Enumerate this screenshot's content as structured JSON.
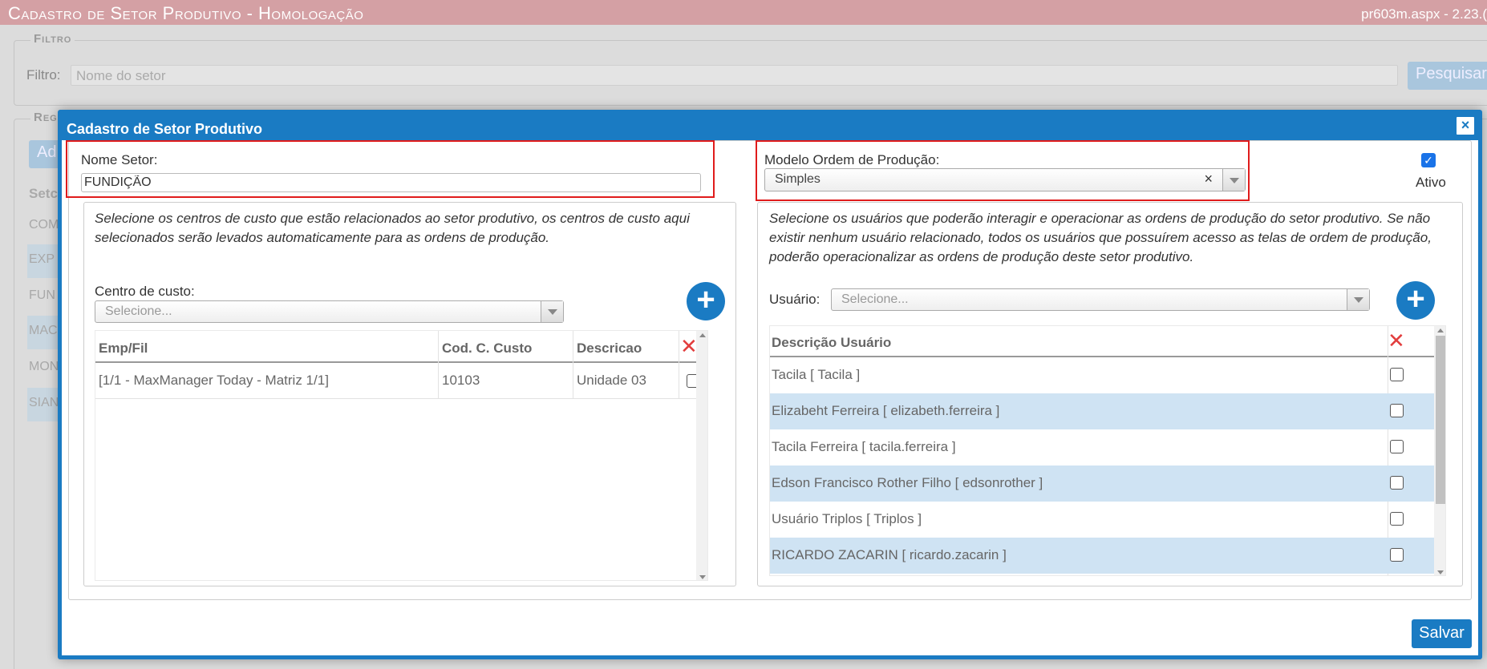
{
  "page": {
    "title": "Cadastro de Setor Produtivo  - Homologação",
    "version": "pr603m.aspx - 2.23.("
  },
  "filter": {
    "legend": "Filtro",
    "label": "Filtro:",
    "placeholder": "Nome do setor",
    "search_label": "Pesquisar"
  },
  "registros": {
    "legend": "Reg",
    "add_label": "Ad",
    "col_label": "Setc",
    "items": [
      "COM",
      "EXP",
      "FUN",
      "MAC",
      "MON",
      "SIAN"
    ]
  },
  "modal": {
    "title": "Cadastro de Setor Produtivo",
    "close_label": "×",
    "nome_setor": {
      "label": "Nome Setor:",
      "value": "FUNDIÇÃO"
    },
    "modelo": {
      "label": "Modelo Ordem de Produção:",
      "value": "Simples",
      "clear": "×"
    },
    "ativo": {
      "label": "Ativo",
      "checked": true
    },
    "centro": {
      "description": "Selecione os centros de custo que estão relacionados ao setor produtivo, os centros de custo aqui selecionados serão levados automaticamente para as ordens de produção.",
      "label": "Centro de custo:",
      "placeholder": "Selecione...",
      "add_label": "+",
      "columns": [
        "Emp/Fil",
        "Cod. C. Custo",
        "Descricao"
      ],
      "rows": [
        {
          "emp": "[1/1 - MaxManager Today - Matriz 1/1]",
          "cod": "10103",
          "desc": "Unidade 03",
          "checked": false
        }
      ]
    },
    "usuarios": {
      "description": "Selecione os usuários que poderão interagir e operacionar as ordens de produção do setor produtivo. Se não existir nenhum usuário relacionado, todos os usuários que possuírem acesso as telas de ordem de produção, poderão operacionalizar as ordens de produção deste setor produtivo.",
      "label": "Usuário:",
      "placeholder": "Selecione...",
      "add_label": "+",
      "column": "Descrição Usuário",
      "rows": [
        {
          "name": "Tacila [ Tacila ]",
          "checked": false
        },
        {
          "name": "Elizabeht Ferreira [ elizabeth.ferreira ]",
          "checked": false
        },
        {
          "name": "Tacila Ferreira [ tacila.ferreira ]",
          "checked": false
        },
        {
          "name": "Edson Francisco Rother Filho [ edsonrother ]",
          "checked": false
        },
        {
          "name": "Usuário Triplos [ Triplos ]",
          "checked": false
        },
        {
          "name": "RICARDO ZACARIN [ ricardo.zacarin ]",
          "checked": false
        }
      ]
    },
    "delete_label": "✕",
    "save_label": "Salvar"
  },
  "colors": {
    "accent": "#1a7bc3",
    "highlight": "#e01b1b",
    "delete": "#e23d3d",
    "row_alt": "#cfe3f3",
    "topbar": "#d4a0a4"
  }
}
